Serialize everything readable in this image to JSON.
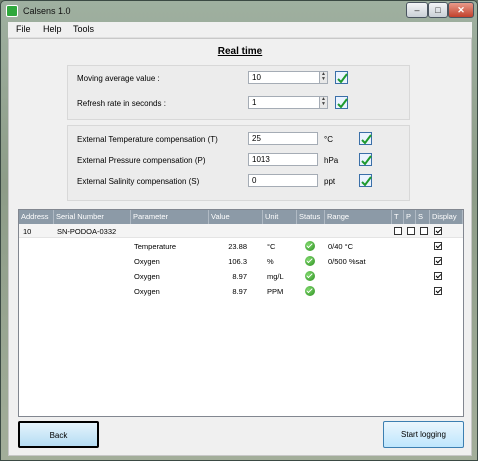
{
  "window": {
    "title": "Calsens 1.0",
    "controls": {
      "minimize": "–",
      "maximize": "□",
      "close": "✕"
    }
  },
  "menu": [
    "File",
    "Help",
    "Tools"
  ],
  "heading": "Real time",
  "settings": {
    "moving_average": {
      "label": "Moving average value :",
      "value": "10"
    },
    "refresh_rate": {
      "label": "Refresh rate in seconds :",
      "value": "1"
    }
  },
  "compensation": {
    "temperature": {
      "label": "External Temperature compensation (T)",
      "value": "25",
      "unit": "°C"
    },
    "pressure": {
      "label": "External Pressure compensation (P)",
      "value": "1013",
      "unit": "hPa"
    },
    "salinity": {
      "label": "External Salinity compensation (S)",
      "value": "0",
      "unit": "ppt"
    }
  },
  "table": {
    "headers": [
      "Address",
      "Serial Number",
      "Parameter",
      "Value",
      "Unit",
      "Status",
      "Range",
      "T",
      "P",
      "S",
      "Display"
    ],
    "device": {
      "address": "10",
      "serial": "SN-PODOA-0332",
      "t": false,
      "p": false,
      "s": false,
      "display": true
    },
    "rows": [
      {
        "parameter": "Temperature",
        "value": "23.88",
        "unit": "°C",
        "status": "ok",
        "range": "0/40 °C",
        "display": true
      },
      {
        "parameter": "Oxygen",
        "value": "106.3",
        "unit": "%",
        "status": "ok",
        "range": "0/500 %sat",
        "display": true
      },
      {
        "parameter": "Oxygen",
        "value": "8.97",
        "unit": "mg/L",
        "status": "ok",
        "range": "",
        "display": true
      },
      {
        "parameter": "Oxygen",
        "value": "8.97",
        "unit": "PPM",
        "status": "ok",
        "range": "",
        "display": true
      }
    ]
  },
  "buttons": {
    "back": "Back",
    "start": "Start logging"
  }
}
